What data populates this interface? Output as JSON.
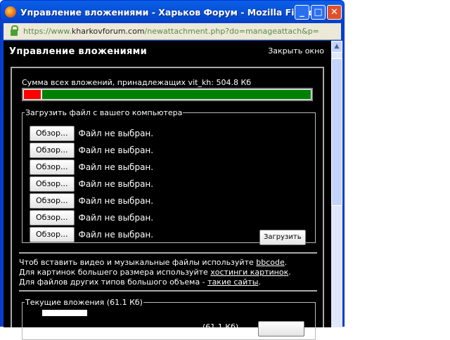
{
  "window": {
    "title": "Управление вложениями - Харьков Форум - Mozilla Firefox"
  },
  "address": {
    "prefix": "https://www.",
    "host": "kharkovforum.com",
    "path": "/newattachment.php?do=manageattach&p="
  },
  "page": {
    "heading": "Управление вложениями",
    "close_link": "Закрыть окно",
    "quota_text": "Сумма всех вложений, принадлежащих vit_kh: 504.8 Кб",
    "quota_used_percent": 6,
    "upload": {
      "legend": "Загрузить файл с вашего компьютера",
      "browse_label": "Обзор...",
      "no_file": "Файл не выбран.",
      "rows": 7,
      "submit_label": "Загрузить"
    },
    "info": {
      "line1": "Чтоб вставить видео и музыкальные файлы используйте ",
      "link1": "bbcode",
      "line2": "Для картинок большего размера используйте ",
      "link2": "хостинги картинок",
      "line3": "Для файлов других типов большого объема - ",
      "link3": "такие сайты",
      "dot": "."
    },
    "current": {
      "legend": "Текущие вложения (61.1 Кб)",
      "size": "(61.1 Кб)"
    }
  }
}
